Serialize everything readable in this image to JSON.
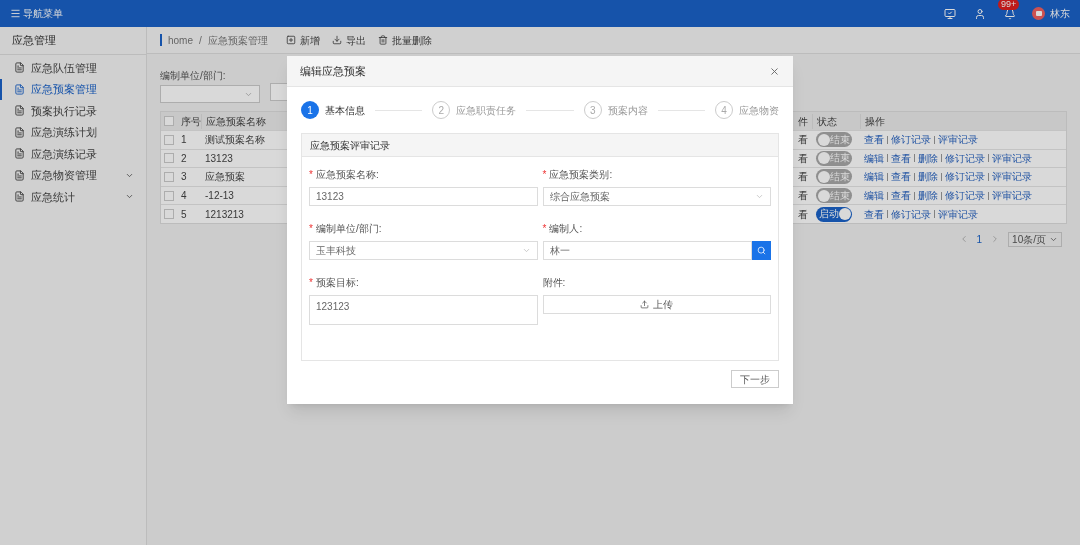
{
  "topbar": {
    "menu_label": "导航菜单",
    "badge": "99+",
    "user": "林东"
  },
  "sidebar": {
    "title": "应急管理",
    "items": [
      {
        "label": "应急队伍管理",
        "selected": false,
        "expandable": false
      },
      {
        "label": "应急预案管理",
        "selected": true,
        "expandable": false
      },
      {
        "label": "预案执行记录",
        "selected": false,
        "expandable": false
      },
      {
        "label": "应急演练计划",
        "selected": false,
        "expandable": false
      },
      {
        "label": "应急演练记录",
        "selected": false,
        "expandable": false
      },
      {
        "label": "应急物资管理",
        "selected": false,
        "expandable": true
      },
      {
        "label": "应急统计",
        "selected": false,
        "expandable": true
      }
    ]
  },
  "breadcrumb": {
    "items": [
      "home",
      "应急预案管理"
    ],
    "separator": "/"
  },
  "toolbar": [
    {
      "kind": "add",
      "label": "新增"
    },
    {
      "kind": "export",
      "label": "导出"
    },
    {
      "kind": "delete",
      "label": "批量删除"
    }
  ],
  "filters": [
    {
      "label": "编制单位/部门:"
    }
  ],
  "table": {
    "select_all_checked": false,
    "left_columns": [
      "序号",
      "应急预案名称"
    ],
    "right_columns": [
      "件",
      "状态",
      "操作"
    ],
    "rows": [
      {
        "checked": false,
        "index": "1",
        "name": "测试预案名称",
        "attachment": "看",
        "status": {
          "label": "结束",
          "on": false
        },
        "actions": [
          "查看",
          "修订记录",
          "评审记录"
        ]
      },
      {
        "checked": false,
        "index": "2",
        "name": "13123",
        "attachment": "看",
        "status": {
          "label": "结束",
          "on": false
        },
        "actions": [
          "编辑",
          "查看",
          "删除",
          "修订记录",
          "评审记录"
        ]
      },
      {
        "checked": false,
        "index": "3",
        "name": "应急预案",
        "attachment": "看",
        "status": {
          "label": "结束",
          "on": false
        },
        "actions": [
          "编辑",
          "查看",
          "删除",
          "修订记录",
          "评审记录"
        ]
      },
      {
        "checked": false,
        "index": "4",
        "name": "-12-13",
        "attachment": "看",
        "status": {
          "label": "结束",
          "on": false
        },
        "actions": [
          "编辑",
          "查看",
          "删除",
          "修订记录",
          "评审记录"
        ]
      },
      {
        "checked": false,
        "index": "5",
        "name": "1213213",
        "attachment": "看",
        "status": {
          "label": "启动",
          "on": true
        },
        "actions": [
          "查看",
          "修订记录",
          "评审记录"
        ]
      }
    ]
  },
  "pagination": {
    "page": "1",
    "page_size": "10条/页"
  },
  "dialog": {
    "title": "编辑应急预案",
    "steps": [
      {
        "number": "1",
        "label": "基本信息",
        "selected": true
      },
      {
        "number": "2",
        "label": "应急职责任务",
        "selected": false
      },
      {
        "number": "3",
        "label": "预案内容",
        "selected": false
      },
      {
        "number": "4",
        "label": "应急物资",
        "selected": false
      }
    ],
    "section_title": "应急预案评审记录",
    "fields": [
      {
        "kind": "text",
        "label": "应急预案名称:",
        "required_mark": "*",
        "value": "13123"
      },
      {
        "kind": "select",
        "label": "应急预案类别:",
        "required_mark": "*",
        "value": "综合应急预案"
      },
      {
        "kind": "select",
        "label": "编制单位/部门:",
        "required_mark": "*",
        "value": "玉丰科技"
      },
      {
        "kind": "search",
        "label": "编制人:",
        "required_mark": "*",
        "value": "林一"
      },
      {
        "kind": "textarea",
        "label": "预案目标:",
        "required_mark": "*",
        "value": "123123"
      },
      {
        "kind": "upload",
        "label": "附件:",
        "button": "上传"
      }
    ],
    "next_button": "下一步"
  }
}
